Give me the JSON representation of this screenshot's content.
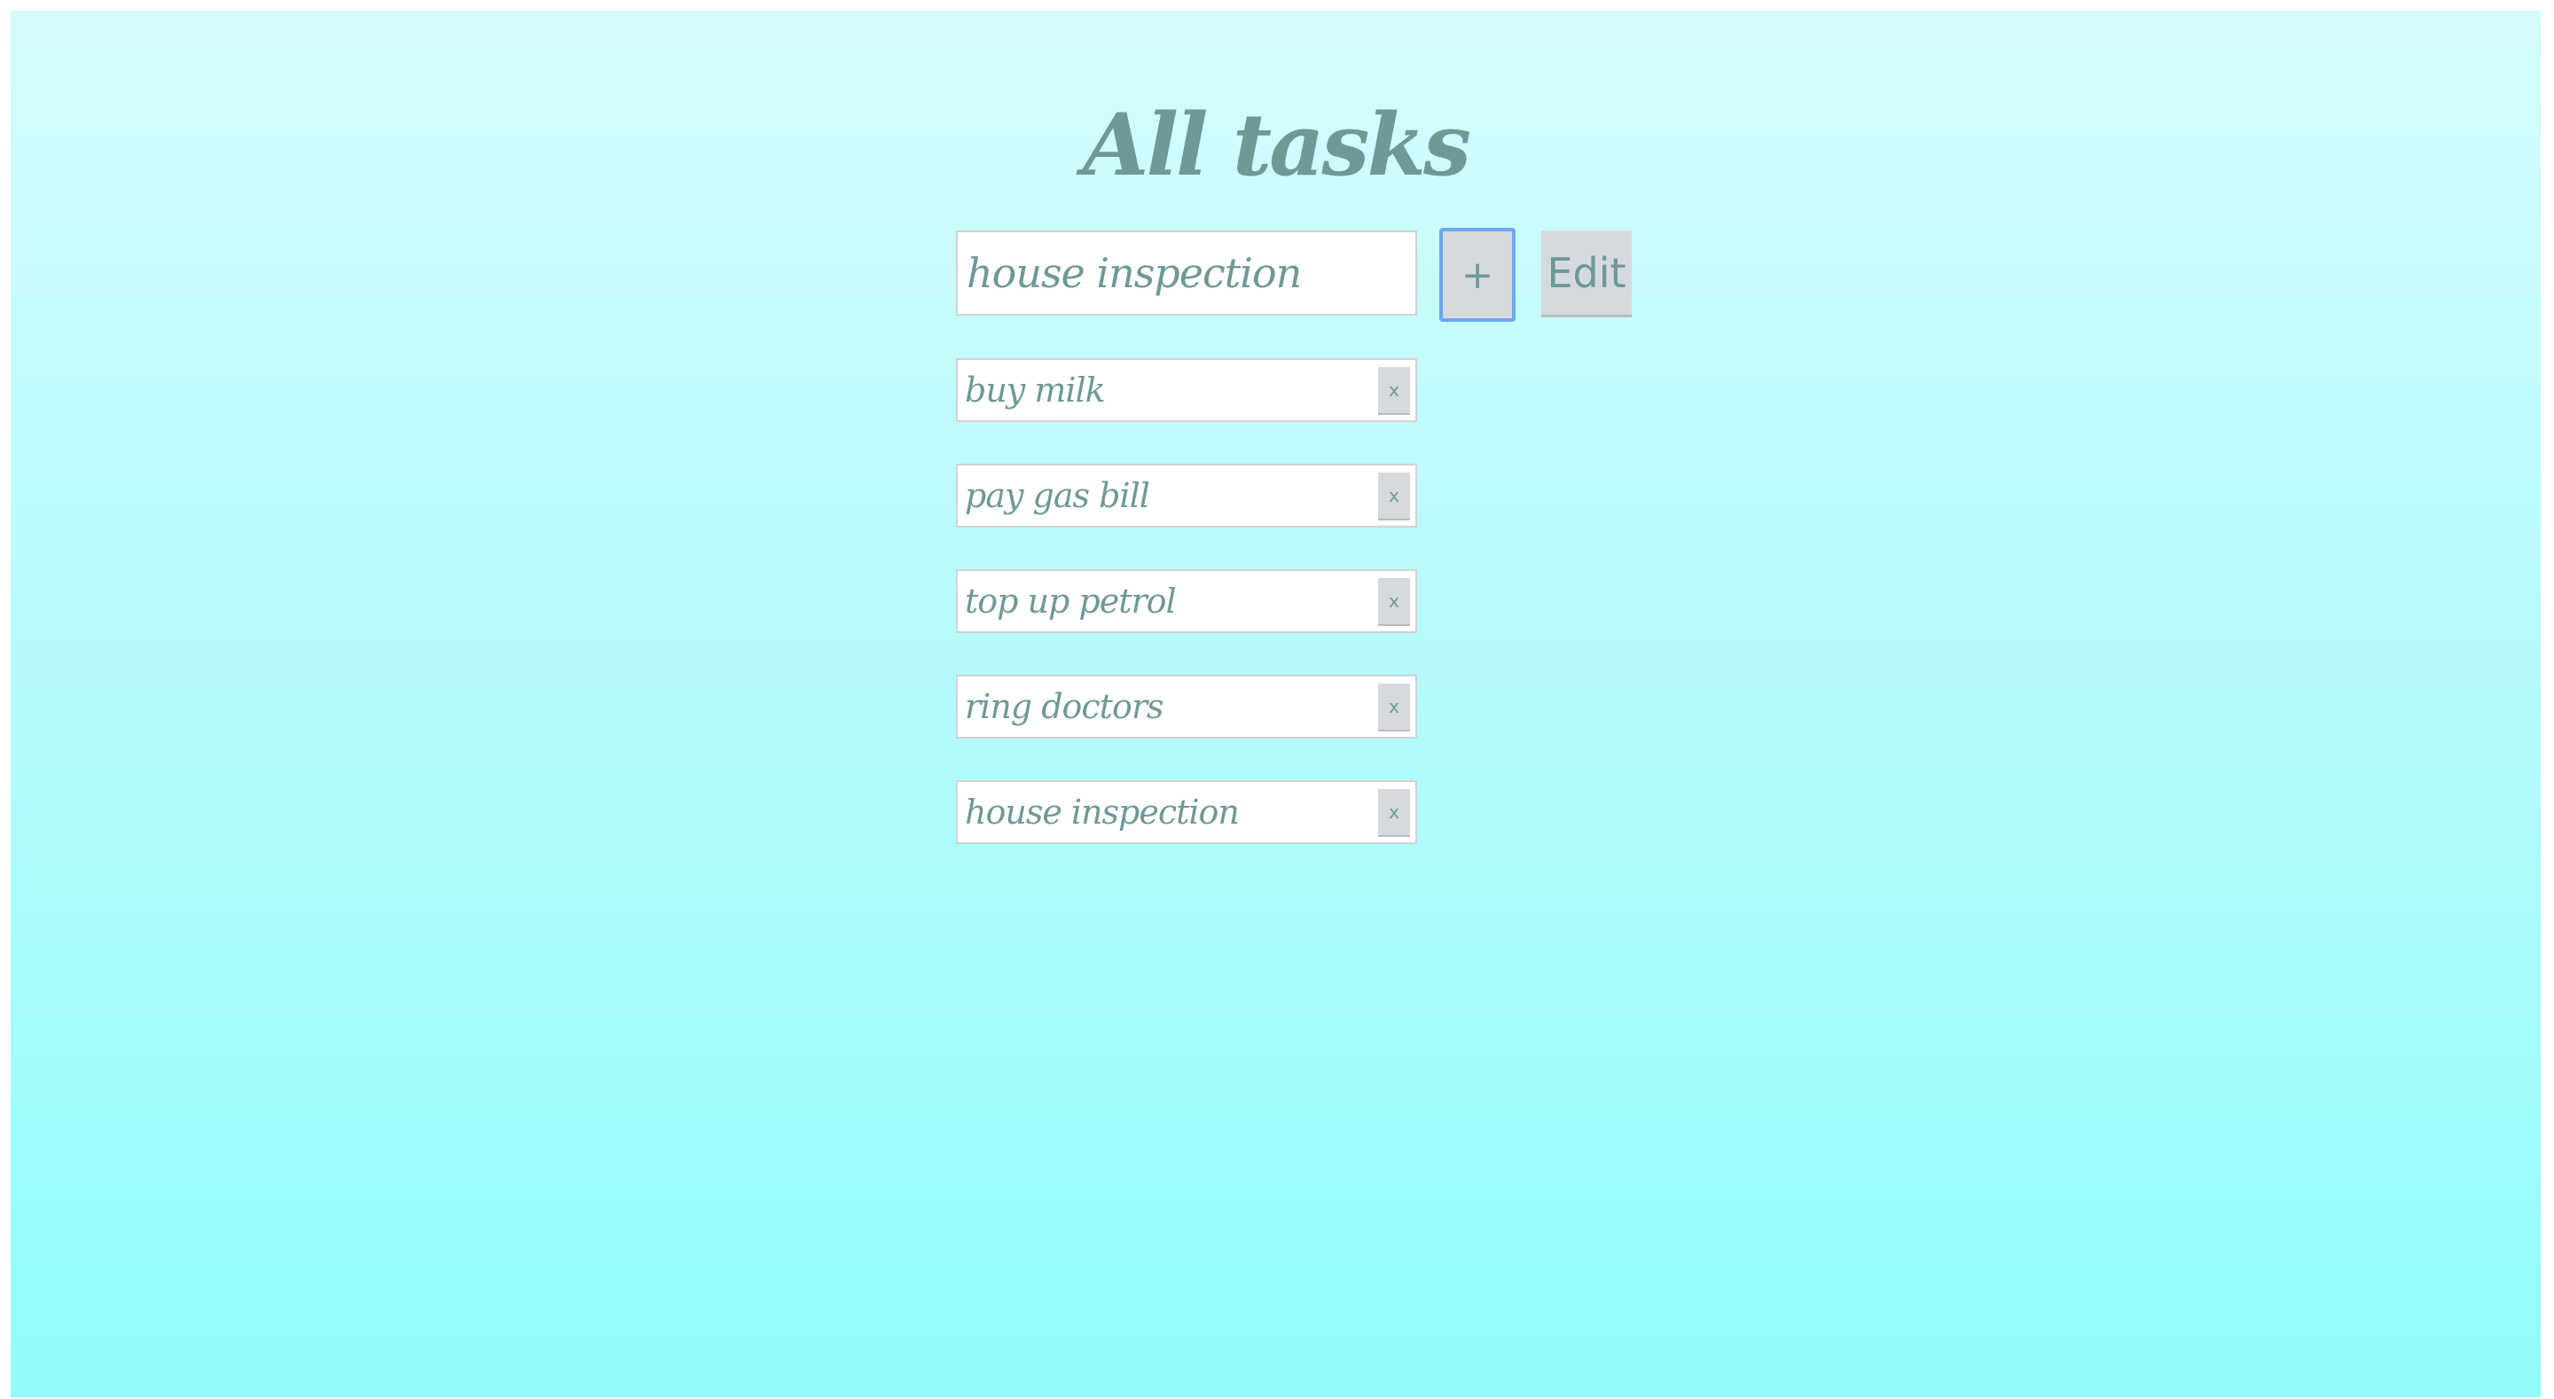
{
  "header": {
    "title": "All tasks"
  },
  "new_task": {
    "value": "house inspection",
    "add_label": "+",
    "edit_label": "Edit"
  },
  "tasks": [
    {
      "label": "buy milk",
      "delete_label": "x"
    },
    {
      "label": "pay gas bill",
      "delete_label": "x"
    },
    {
      "label": "top up petrol",
      "delete_label": "x"
    },
    {
      "label": "ring doctors",
      "delete_label": "x"
    },
    {
      "label": "house inspection",
      "delete_label": "x"
    }
  ],
  "colors": {
    "text": "#6f9898",
    "gradient_top": "#d5fcfc",
    "gradient_bottom": "#92fbfb",
    "button_bg": "#d6d9de",
    "focus_ring": "#6aa8f0"
  }
}
